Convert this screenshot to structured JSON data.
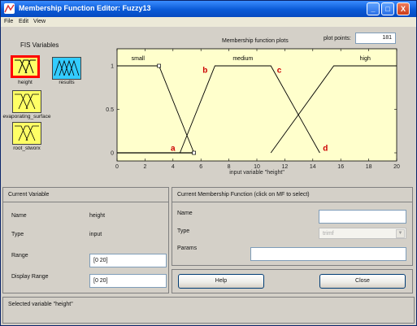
{
  "window": {
    "title": "Membership Function Editor: Fuzzy13",
    "buttons": {
      "minimize": "_",
      "maximize": "□",
      "close": "X"
    }
  },
  "menu": [
    "File",
    "Edit",
    "View"
  ],
  "fis": {
    "heading": "FIS Variables",
    "variables": [
      {
        "label": "height",
        "kind": "input",
        "selected": true
      },
      {
        "label": "results",
        "kind": "output",
        "selected": false
      },
      {
        "label": "evaporating_surface",
        "kind": "input",
        "selected": false
      },
      {
        "label": "root_stworx",
        "kind": "input",
        "selected": false
      }
    ]
  },
  "plot": {
    "title": "Membership function plots",
    "plot_points_label": "plot points:",
    "plot_points_value": "181",
    "xlabel": "input variable \"height\""
  },
  "chart_data": {
    "type": "line",
    "xlim": [
      0,
      20
    ],
    "ylim": [
      0,
      1
    ],
    "x_ticks": [
      0,
      2,
      4,
      6,
      8,
      10,
      12,
      14,
      16,
      18,
      20
    ],
    "y_ticks": [
      0,
      0.5,
      1
    ],
    "y_tick_labels": [
      "0",
      "0.5",
      "1"
    ],
    "series": [
      {
        "name": "small",
        "x": [
          0,
          3,
          5.5
        ],
        "y": [
          1,
          1,
          0
        ]
      },
      {
        "name": "medium",
        "x": [
          4.5,
          7,
          11,
          14.5
        ],
        "y": [
          0,
          1,
          1,
          0
        ]
      },
      {
        "name": "high",
        "x": [
          11,
          15.5,
          20
        ],
        "y": [
          0,
          1,
          1
        ]
      }
    ],
    "annotations": [
      {
        "text": "a",
        "x": 4,
        "y": 0.05,
        "color": "#cc0000"
      },
      {
        "text": "b",
        "x": 6.3,
        "y": 0.95,
        "color": "#cc0000"
      },
      {
        "text": "c",
        "x": 11.6,
        "y": 0.95,
        "color": "#cc0000"
      },
      {
        "text": "d",
        "x": 14.9,
        "y": 0.05,
        "color": "#cc0000"
      }
    ],
    "background": "#ffffcc"
  },
  "current_variable": {
    "heading": "Current Variable",
    "name_label": "Name",
    "name_value": "height",
    "type_label": "Type",
    "type_value": "input",
    "range_label": "Range",
    "range_value": "[0 20]",
    "display_range_label": "Display Range",
    "display_range_value": "[0 20]"
  },
  "current_mf": {
    "heading": "Current Membership Function (click on MF to select)",
    "name_label": "Name",
    "name_value": "",
    "type_label": "Type",
    "type_value": "trimf",
    "params_label": "Params",
    "params_value": ""
  },
  "buttons": {
    "help": "Help",
    "close": "Close"
  },
  "status": "Selected variable \"height\"",
  "colors": {
    "selected_border": "#ff0000",
    "tile_yellow": "#ffff66",
    "tile_cyan": "#33ccff",
    "title_blue": "#0a5ad6"
  }
}
